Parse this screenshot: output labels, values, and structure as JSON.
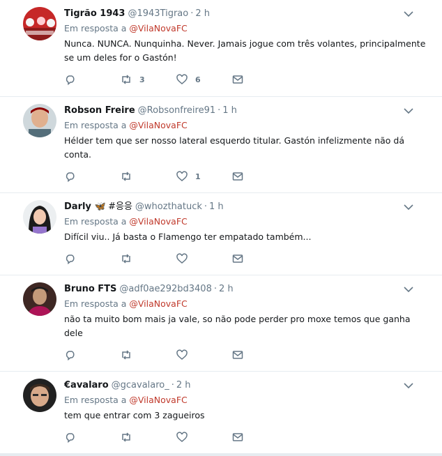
{
  "tweets": [
    {
      "name": "Tigrão 1943",
      "handle": "@1943Tigrao",
      "time": "2 h",
      "reply_prefix": "Em resposta a",
      "reply_to": "@VilaNovaFC",
      "text": "Nunca. NUNCA. Nunquinha. Never. Jamais jogue com três volantes, principalmente se um deles for o Gastón!",
      "retweets": "3",
      "likes": "6"
    },
    {
      "name": "Robson Freire",
      "handle": "@Robsonfreire91",
      "time": "1 h",
      "reply_prefix": "Em resposta a",
      "reply_to": "@VilaNovaFC",
      "text": "Hélder tem que ser nosso lateral esquerdo titular. Gastón infelizmente não dá conta.",
      "retweets": "",
      "likes": "1"
    },
    {
      "name": "Darly",
      "name_extra": "#응응",
      "handle": "@whozthatuck",
      "time": "1 h",
      "reply_prefix": "Em resposta a",
      "reply_to": "@VilaNovaFC",
      "text": "Difícil viu.. Já basta o Flamengo ter empatado também...",
      "retweets": "",
      "likes": ""
    },
    {
      "name": "Bruno FTS",
      "handle": "@adf0ae292bd3408",
      "time": "2 h",
      "reply_prefix": "Em resposta a",
      "reply_to": "@VilaNovaFC",
      "text": "não ta muito bom mais ja vale, so não pode perder pro moxe temos que ganha dele",
      "retweets": "",
      "likes": ""
    },
    {
      "name": "€avalaro",
      "handle": "@gcavalaro_",
      "time": "2 h",
      "reply_prefix": "Em resposta a",
      "reply_to": "@VilaNovaFC",
      "text": "tem que entrar com 3 zagueiros",
      "retweets": "",
      "likes": ""
    }
  ],
  "colors": {
    "accent_link": "#c0392b",
    "muted": "#657786",
    "divider": "#e6ecf0"
  },
  "icons": [
    "reply-icon",
    "retweet-icon",
    "like-icon",
    "direct-message-icon",
    "chevron-down-icon",
    "butterfly-emoji"
  ]
}
